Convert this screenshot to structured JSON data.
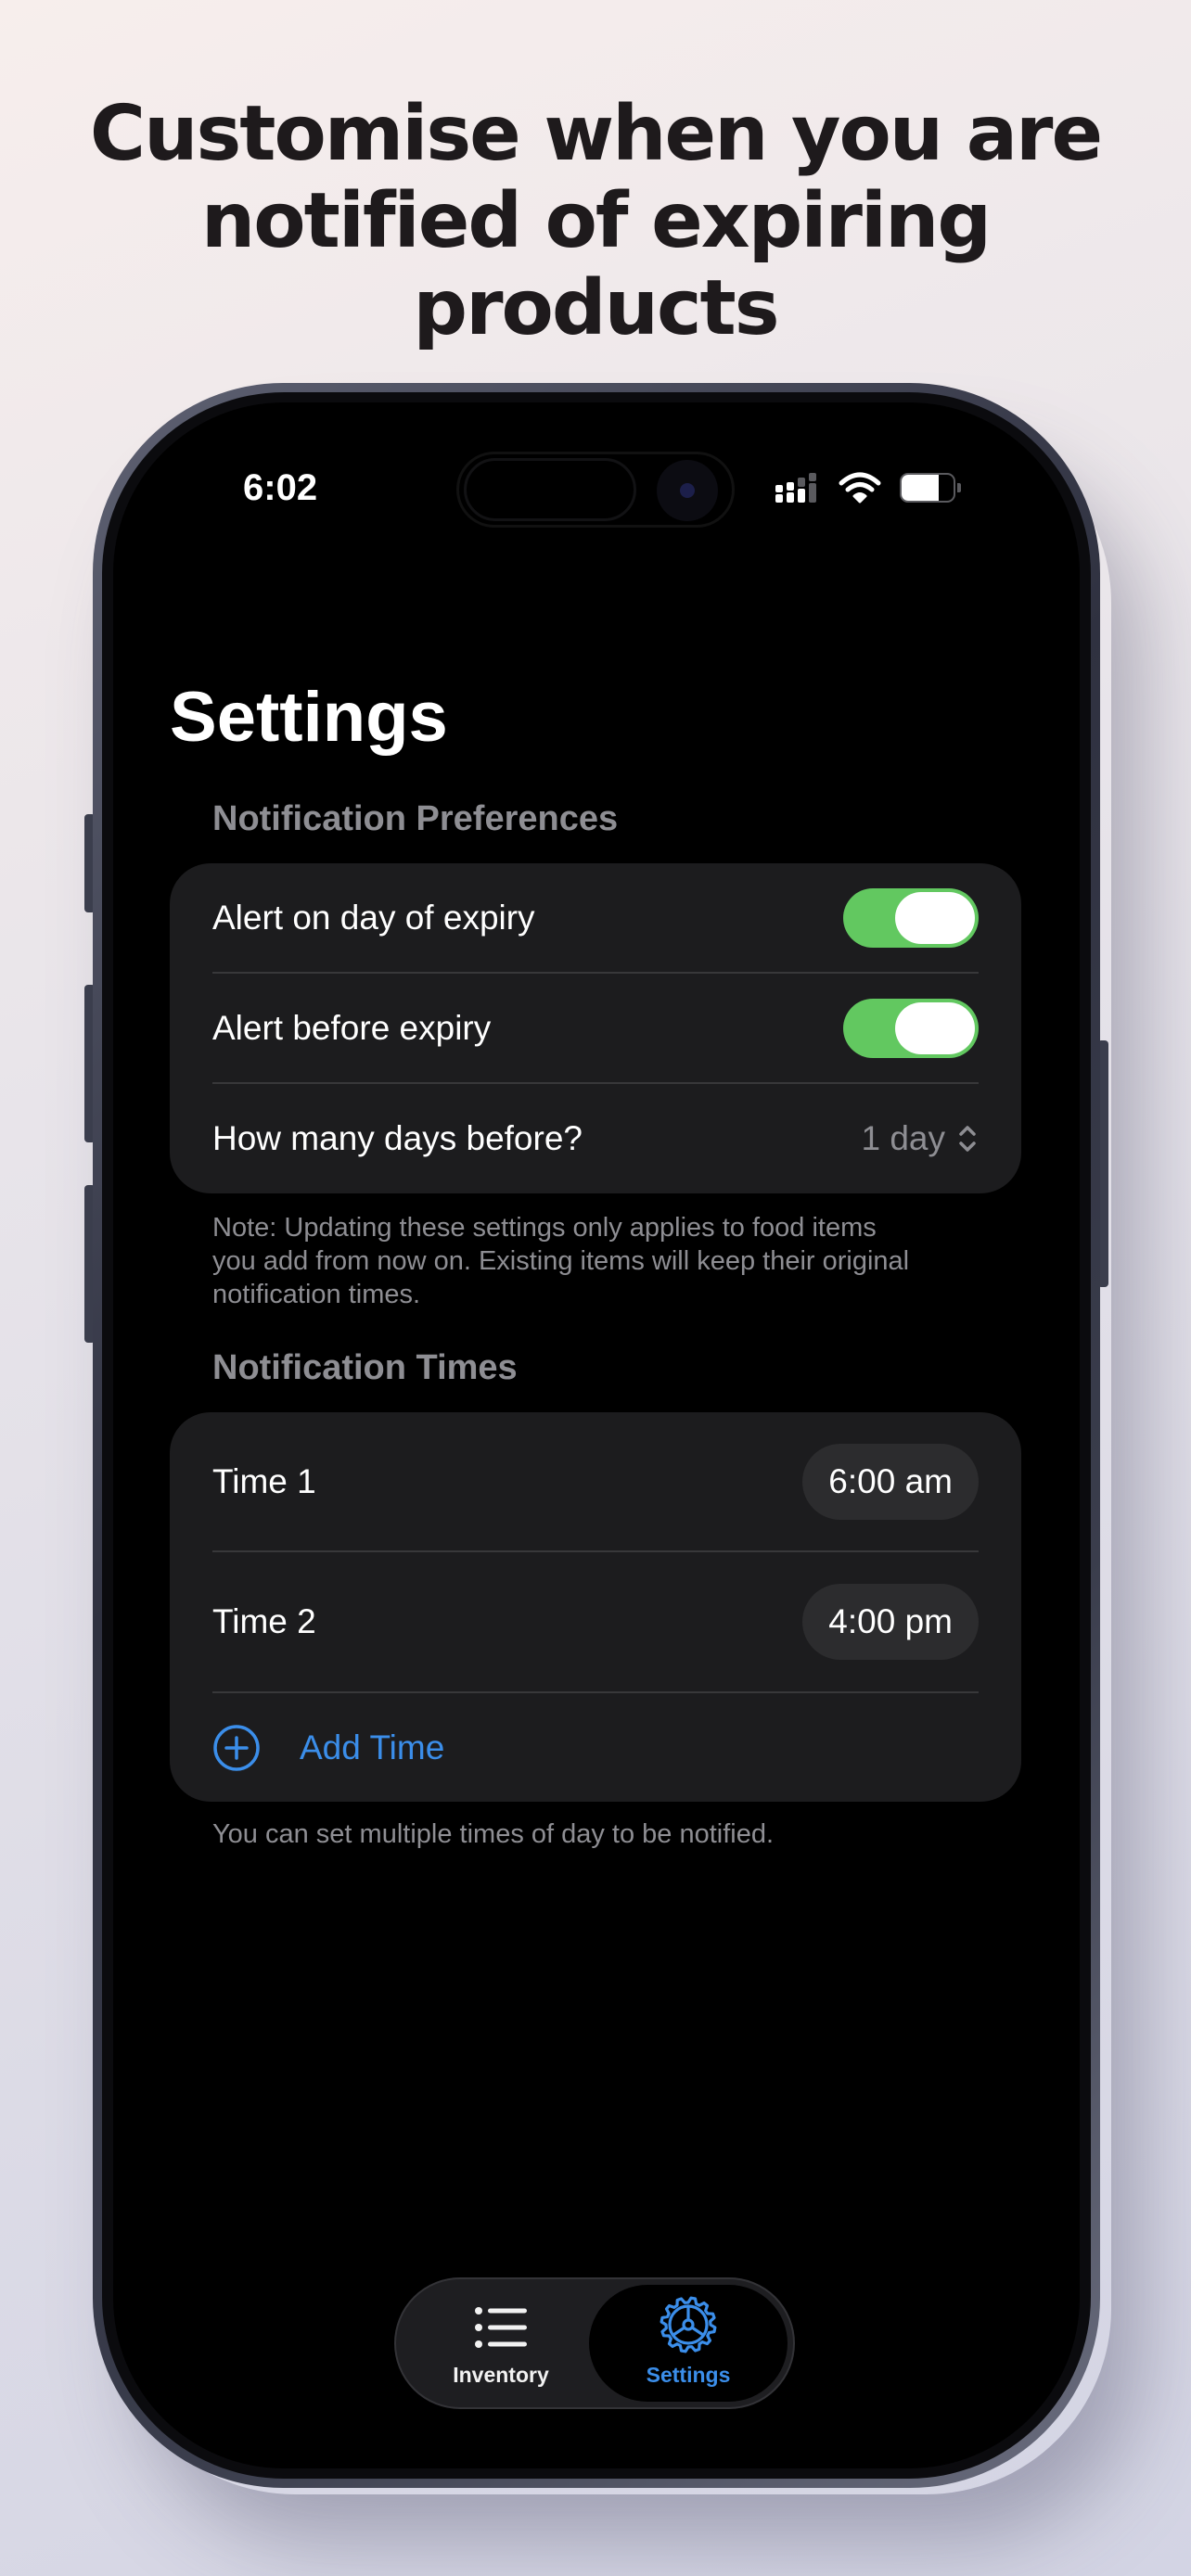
{
  "promo": {
    "headline_line1": "Customise when you are",
    "headline_line2": "notified of expiring",
    "headline_line3": "products"
  },
  "status_bar": {
    "time": "6:02",
    "icons": [
      "cellular-signal-icon",
      "wifi-icon",
      "battery-icon"
    ],
    "battery_level": 0.72
  },
  "screen_title": "Settings",
  "notification_preferences": {
    "header": "Notification Preferences",
    "rows": [
      {
        "label": "Alert on day of expiry",
        "toggle_on": true
      },
      {
        "label": "Alert before expiry",
        "toggle_on": true
      },
      {
        "label": "How many days before?",
        "value": "1 day"
      }
    ],
    "footnote_line1": "Note: Updating these settings only applies to food items",
    "footnote_line2": "you add from now on. Existing items will keep their original",
    "footnote_line3": "notification times."
  },
  "notification_times": {
    "header": "Notification Times",
    "times": [
      {
        "label": "Time 1",
        "value": "6:00 am"
      },
      {
        "label": "Time 2",
        "value": "4:00 pm"
      }
    ],
    "add_label": "Add Time",
    "footnote": "You can set multiple times of day to be notified."
  },
  "tab_bar": {
    "tabs": [
      {
        "label": "Inventory",
        "icon": "list-icon",
        "selected": false
      },
      {
        "label": "Settings",
        "icon": "gear-icon",
        "selected": true
      }
    ]
  },
  "colors": {
    "accent": "#3b8eea",
    "toggle_on": "#62c860",
    "card_background": "#1c1c1e",
    "secondary_text": "#8e8e93"
  }
}
